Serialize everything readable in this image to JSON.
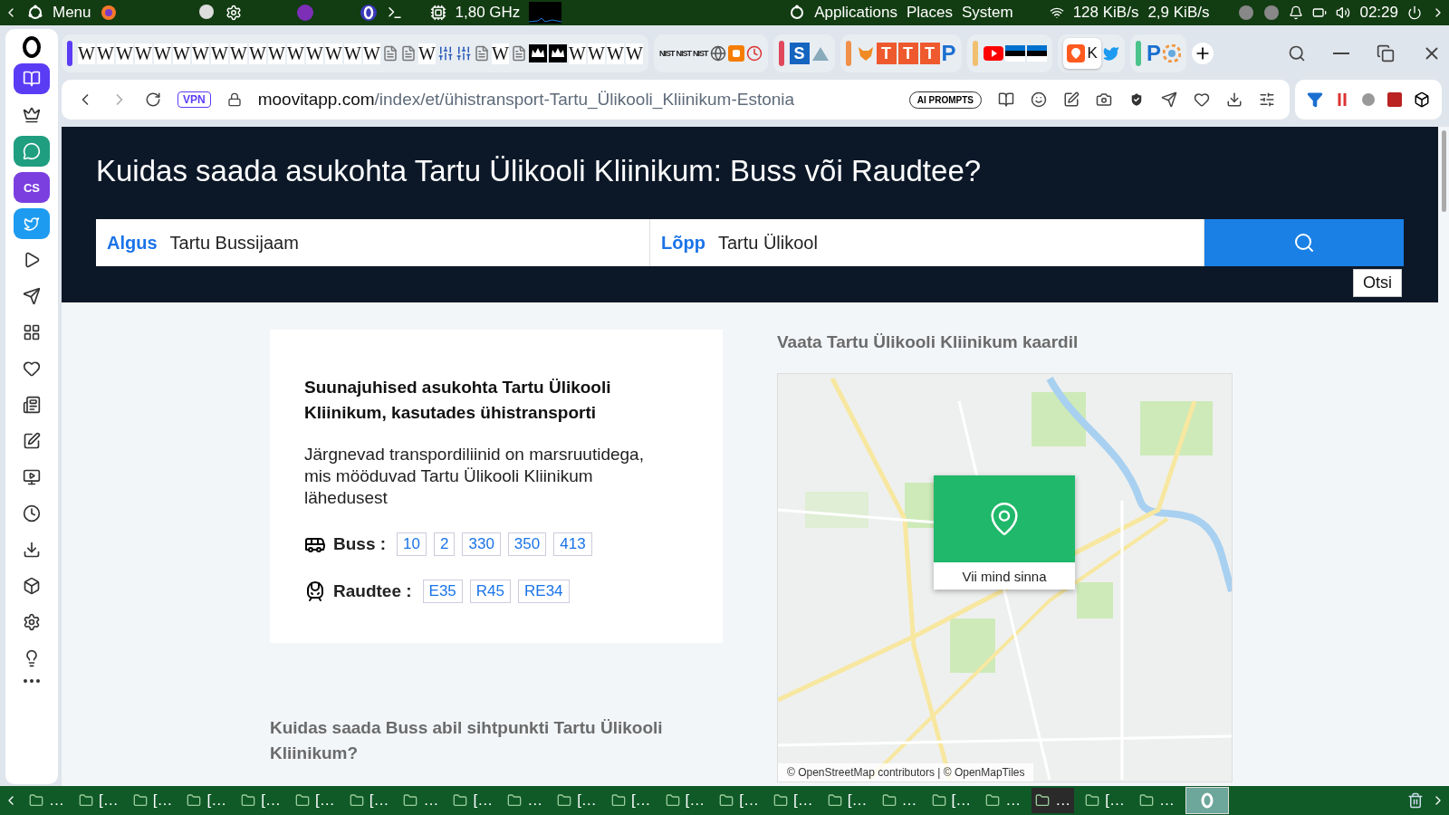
{
  "panel": {
    "menu": "Menu",
    "cpu": "1,80 GHz",
    "places": [
      "Applications",
      "Places",
      "System"
    ],
    "down": "128 KiB/s",
    "up": "2,9 KiB/s",
    "clock": "02:29"
  },
  "sidebar": {
    "items": [
      {
        "kind": "book",
        "selected": true
      },
      {
        "kind": "crown",
        "selected": false
      },
      {
        "kind": "chat",
        "selected": false
      },
      {
        "kind": "cs",
        "label": "CS",
        "selected": false
      },
      {
        "kind": "bird",
        "selected": false
      },
      {
        "kind": "play",
        "selected": false
      },
      {
        "kind": "send",
        "selected": false
      },
      {
        "kind": "grid",
        "selected": false
      },
      {
        "kind": "heart",
        "selected": false
      },
      {
        "kind": "news",
        "selected": false
      },
      {
        "kind": "pen",
        "selected": false
      },
      {
        "kind": "tv",
        "selected": false
      },
      {
        "kind": "clock",
        "selected": false
      },
      {
        "kind": "download",
        "selected": false
      },
      {
        "kind": "box",
        "selected": false
      },
      {
        "kind": "settings",
        "selected": false
      },
      {
        "kind": "bulb",
        "selected": false
      }
    ]
  },
  "tab_groups": [
    {
      "color": "#5b3cf5",
      "tabs": [
        {
          "kind": "letter",
          "label": "W",
          "selected": false
        },
        {
          "kind": "letter",
          "label": "W",
          "selected": false
        },
        {
          "kind": "letter",
          "label": "W",
          "selected": false
        },
        {
          "kind": "letter",
          "label": "W",
          "selected": false
        },
        {
          "kind": "letter",
          "label": "W",
          "selected": false
        },
        {
          "kind": "letter",
          "label": "W",
          "selected": false
        },
        {
          "kind": "letter",
          "label": "W",
          "selected": false
        },
        {
          "kind": "letter",
          "label": "W",
          "selected": false
        },
        {
          "kind": "letter",
          "label": "W",
          "selected": false
        },
        {
          "kind": "letter",
          "label": "W",
          "selected": false
        },
        {
          "kind": "letter",
          "label": "W",
          "selected": false
        },
        {
          "kind": "letter",
          "label": "W",
          "selected": false
        },
        {
          "kind": "letter",
          "label": "W",
          "selected": false
        },
        {
          "kind": "letter",
          "label": "W",
          "selected": false
        },
        {
          "kind": "letter",
          "label": "W",
          "selected": false
        },
        {
          "kind": "letter",
          "label": "W",
          "selected": false
        },
        {
          "kind": "page",
          "selected": false
        },
        {
          "kind": "page",
          "selected": false
        },
        {
          "kind": "letter",
          "label": "W",
          "selected": false
        },
        {
          "kind": "mixer",
          "selected": false
        },
        {
          "kind": "mixer",
          "selected": false
        },
        {
          "kind": "page",
          "selected": false
        },
        {
          "kind": "letter",
          "label": "W",
          "selected": false
        },
        {
          "kind": "page",
          "selected": false
        },
        {
          "kind": "crown",
          "selected": false
        },
        {
          "kind": "crown",
          "selected": false
        },
        {
          "kind": "letter",
          "label": "W",
          "selected": false
        },
        {
          "kind": "letter",
          "label": "W",
          "selected": false
        },
        {
          "kind": "letter",
          "label": "W",
          "selected": false
        },
        {
          "kind": "letter",
          "label": "W",
          "selected": false
        }
      ]
    },
    {
      "tabs": [
        {
          "kind": "small",
          "label": "NIST",
          "selected": false
        },
        {
          "kind": "small",
          "label": "NIST",
          "selected": false
        },
        {
          "kind": "small",
          "label": "NIST",
          "selected": false
        },
        {
          "kind": "globe",
          "selected": false
        },
        {
          "kind": "blog",
          "selected": false
        },
        {
          "kind": "clock",
          "selected": false
        }
      ]
    },
    {
      "color": "#e0485c",
      "tabs": [
        {
          "kind": "tile",
          "label": "S",
          "color": "#1565c0",
          "selected": false
        },
        {
          "kind": "mountain",
          "selected": false
        }
      ]
    },
    {
      "color": "#f0904a",
      "tabs": [
        {
          "kind": "fox",
          "selected": false
        },
        {
          "kind": "tile",
          "label": "T",
          "color": "#ee5a2e",
          "selected": false
        },
        {
          "kind": "tile",
          "label": "T",
          "color": "#ee5a2e",
          "selected": false
        },
        {
          "kind": "tile",
          "label": "T",
          "color": "#ee5a2e",
          "selected": false
        },
        {
          "kind": "plain",
          "label": "P",
          "color": "#1a6fd0",
          "selected": false
        }
      ]
    },
    {
      "color": "#f0c070",
      "tabs": [
        {
          "kind": "video",
          "selected": false
        },
        {
          "kind": "flag",
          "selected": false
        },
        {
          "kind": "flag",
          "selected": false
        }
      ]
    },
    {
      "tabs": [
        {
          "kind": "pin",
          "label": "K",
          "selected": true
        },
        {
          "kind": "bird",
          "selected": false
        }
      ]
    },
    {
      "color": "#4cc38a",
      "tabs": [
        {
          "kind": "plain",
          "label": "P",
          "color": "#1a6fd0",
          "selected": false
        },
        {
          "kind": "swirl",
          "selected": false
        }
      ]
    }
  ],
  "address": {
    "vpn": "VPN",
    "host": "moovitapp.com",
    "path": "/index/et/ühistransport-Tartu_Ülikooli_Kliinikum-Estonia",
    "ai": "AI PROMPTS"
  },
  "page": {
    "title": "Kuidas saada asukohta Tartu Ülikooli Kliinikum: Buss või Raudtee?",
    "search": {
      "start_label": "Algus",
      "start_value": "Tartu Bussijaam",
      "end_label": "Lõpp",
      "end_value": "Tartu Ülikool",
      "tooltip": "Otsi"
    },
    "card": {
      "title": "Suunajuhised asukohta Tartu Ülikooli Kliinikum, kasutades ühistransporti",
      "text": "Järgnevad transpordiliinid on marsruutidega, mis mööduvad Tartu Ülikooli Kliinikum lähedusest",
      "lines": [
        {
          "kind": "bus",
          "label": "Buss :",
          "routes": [
            "10",
            "2",
            "330",
            "350",
            "413"
          ]
        },
        {
          "kind": "rail",
          "label": "Raudtee :",
          "routes": [
            "E35",
            "R45",
            "RE34"
          ]
        }
      ]
    },
    "map": {
      "heading": "Vaata Tartu Ülikooli Kliinikum kaardil",
      "popup": "Vii mind sinna",
      "attribution": "© OpenStreetMap contributors | © OpenMapTiles"
    },
    "section_heading": "Kuidas saada Buss abil sihtpunkti Tartu Ülikooli Kliinikum?"
  },
  "taskbar": {
    "items": [
      {
        "label": "…",
        "selected": false
      },
      {
        "label": "[…",
        "selected": false
      },
      {
        "label": "[…",
        "selected": false
      },
      {
        "label": "[…",
        "selected": false
      },
      {
        "label": "[…",
        "selected": false
      },
      {
        "label": "[…",
        "selected": false
      },
      {
        "label": "[…",
        "selected": false
      },
      {
        "label": "…",
        "selected": false
      },
      {
        "label": "[…",
        "selected": false
      },
      {
        "label": "…",
        "selected": false
      },
      {
        "label": "[…",
        "selected": false
      },
      {
        "label": "[…",
        "selected": false
      },
      {
        "label": "[…",
        "selected": false
      },
      {
        "label": "[…",
        "selected": false
      },
      {
        "label": "[…",
        "selected": false
      },
      {
        "label": "[…",
        "selected": false
      },
      {
        "label": "…",
        "selected": false
      },
      {
        "label": "[…",
        "selected": false
      },
      {
        "label": "…",
        "selected": false
      },
      {
        "label": "…",
        "selected": true
      },
      {
        "label": "[…",
        "selected": false
      },
      {
        "label": "…",
        "selected": false
      }
    ]
  }
}
